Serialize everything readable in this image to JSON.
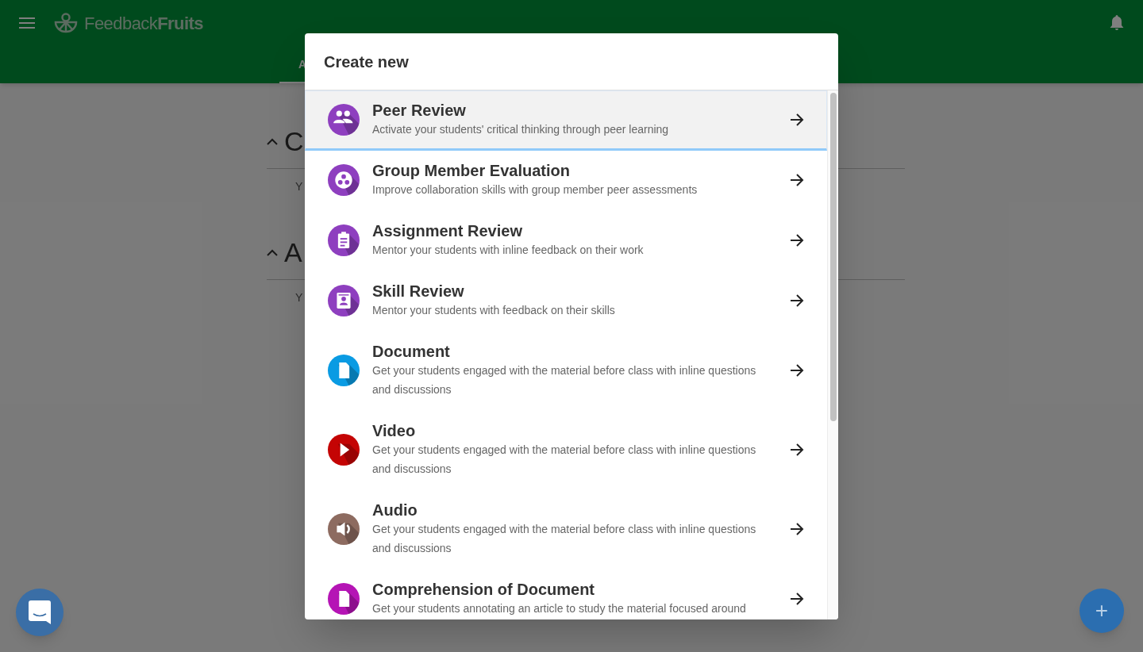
{
  "header": {
    "logo": "Feedback**Fruits**",
    "tab": "A"
  },
  "background_sections": [
    {
      "heading": "C",
      "text": "Y",
      "expanded": true
    },
    {
      "heading": "A",
      "text": "Y",
      "expanded": true
    }
  ],
  "dialog": {
    "title": "Create new",
    "items": [
      {
        "title": "Peer Review",
        "description": "Activate your students' critical thinking through peer learning",
        "kind": "group",
        "color": "#8e3fbf",
        "selected": true
      },
      {
        "title": "Group Member Evaluation",
        "description": "Improve collaboration skills with group member peer assessments",
        "kind": "dots",
        "color": "#8e3fbf",
        "selected": false
      },
      {
        "title": "Assignment Review",
        "description": "Mentor your students with inline feedback on their work",
        "kind": "clipboard",
        "color": "#8e3fbf",
        "selected": false
      },
      {
        "title": "Skill Review",
        "description": "Mentor your students with feedback on their skills",
        "kind": "badge",
        "color": "#8e3fbf",
        "selected": false
      },
      {
        "title": "Document",
        "description": "Get your students engaged with the material before class with inline questions and discussions",
        "kind": "document",
        "color": "#0a9be3",
        "selected": false
      },
      {
        "title": "Video",
        "description": "Get your students engaged with the material before class with inline questions and discussions",
        "kind": "play",
        "color": "#c40404",
        "selected": false
      },
      {
        "title": "Audio",
        "description": "Get your students engaged with the material before class with inline questions and discussions",
        "kind": "speaker",
        "color": "#8d6b60",
        "selected": false
      },
      {
        "title": "Comprehension of Document",
        "description": "Get your students annotating an article to study the material focused around",
        "kind": "document",
        "color": "#b514b5",
        "selected": false
      }
    ]
  },
  "fab": "+"
}
